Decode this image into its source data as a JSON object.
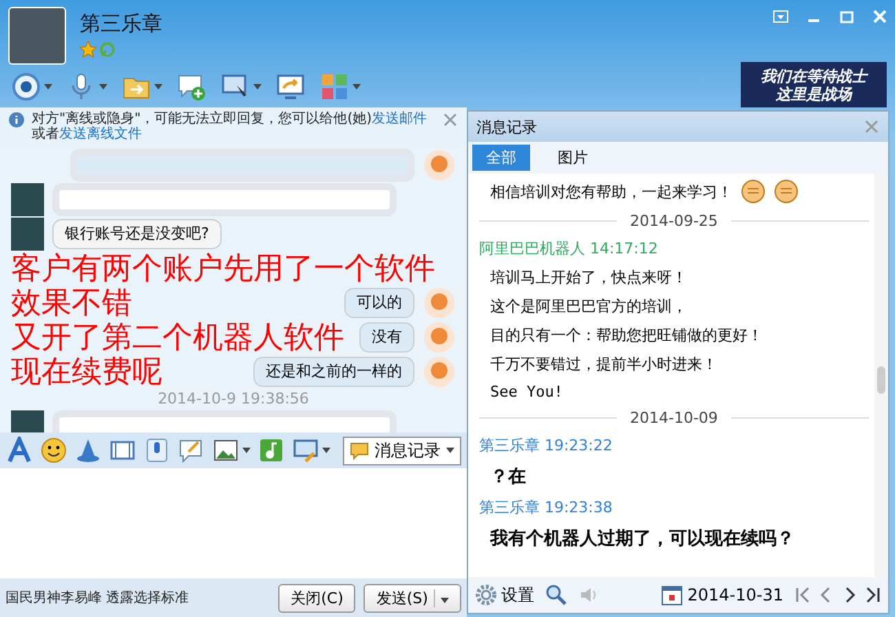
{
  "window": {
    "title": "第三乐章"
  },
  "banner": {
    "lines": [
      "我们在等待战士",
      "这里是战场"
    ]
  },
  "toolbar": [
    {
      "kind": "camera",
      "dropdown": true
    },
    {
      "kind": "mic",
      "dropdown": true
    },
    {
      "kind": "folder",
      "dropdown": true
    },
    {
      "kind": "chat",
      "dropdown": false
    },
    {
      "kind": "screen",
      "dropdown": true
    },
    {
      "kind": "share",
      "dropdown": false
    },
    {
      "kind": "apps",
      "dropdown": true
    }
  ],
  "notice": {
    "text": "对方\"离线或隐身\"，可能无法立即回复，您可以给他(她)",
    "link": "发送邮件",
    "text2": "或者",
    "link2": "发送离线文件"
  },
  "chat": [
    {
      "kind": "image",
      "outgoing": true
    },
    {
      "kind": "image",
      "outgoing": false
    },
    {
      "kind": "text",
      "outgoing": false,
      "text": "银行账号还是没变吧?"
    },
    {
      "kind": "text",
      "outgoing": true,
      "text": "可以的"
    },
    {
      "kind": "text",
      "outgoing": true,
      "text": "没有"
    },
    {
      "kind": "text",
      "outgoing": true,
      "text": "还是和之前的一样的"
    },
    {
      "kind": "time",
      "text": "2014-10-9 19:38:56"
    },
    {
      "kind": "image",
      "outgoing": false
    }
  ],
  "input_toolbar": {
    "history_button": "消息记录"
  },
  "bottom": {
    "ad_text": "国民男神李易峰 透露选择标准",
    "buttons": [
      {
        "label": "关闭(C)",
        "dropdown": false
      },
      {
        "label": "发送(S)",
        "dropdown": true
      }
    ]
  },
  "history": {
    "title": "消息记录",
    "tabs": [
      {
        "label": "全部",
        "selected": true
      },
      {
        "label": "图片",
        "selected": false
      }
    ],
    "entries": [
      {
        "kind": "message",
        "text": "相信培训对您有帮助，一起来学习！",
        "emoji": true
      },
      {
        "kind": "date",
        "text": "2014-09-25"
      },
      {
        "kind": "sender",
        "text": "阿里巴巴机器人 14:17:12",
        "color": "#2eaa5e"
      },
      {
        "kind": "message",
        "text": "培训马上开始了，快点来呀！"
      },
      {
        "kind": "message",
        "text": "这个是阿里巴巴官方的培训，"
      },
      {
        "kind": "message",
        "text": "目的只有一个：帮助您把旺铺做的更好！"
      },
      {
        "kind": "message",
        "text": "千万不要错过，提前半小时进来！"
      },
      {
        "kind": "message",
        "text": "See You!"
      },
      {
        "kind": "date",
        "text": "2014-10-09"
      },
      {
        "kind": "sender",
        "text": "第三乐章 19:23:22",
        "color": "#2f7fe0"
      },
      {
        "kind": "big",
        "text": "？在"
      },
      {
        "kind": "sender",
        "text": "第三乐章 19:23:38",
        "color": "#2f7fe0"
      },
      {
        "kind": "big",
        "text": "我有个机器人过期了，可以现在续吗？"
      }
    ],
    "footer": {
      "settings": "设置",
      "date": "2014-10-31"
    }
  },
  "overlay": {
    "lines": [
      "客户有两个账户先用了一个软件",
      "效果不错",
      "又开了第二个机器人软件",
      "现在续费呢"
    ]
  }
}
